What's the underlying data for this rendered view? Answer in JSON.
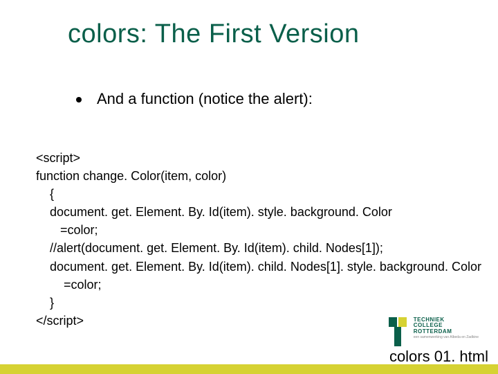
{
  "title": "colors: The First Version",
  "bullet": "And a function (notice the alert):",
  "code": "<script>\nfunction change. Color(item, color)\n    {\n    document. get. Element. By. Id(item). style. background. Color\n       =color;\n    //alert(document. get. Element. By. Id(item). child. Nodes[1]);\n    document. get. Element. By. Id(item). child. Nodes[1]. style. background. Color\n        =color;\n    }\n</script>",
  "filename": "colors 01. html",
  "logo": {
    "line1": "TECHNIEK",
    "line2": "COLLEGE",
    "line3": "ROTTERDAM",
    "sub": "een samenwerking van Albeda en Zadkine"
  }
}
